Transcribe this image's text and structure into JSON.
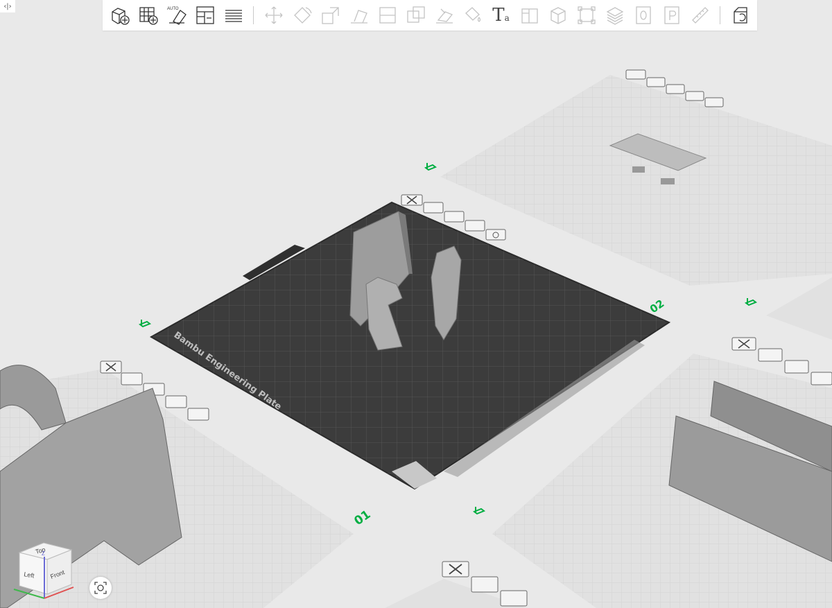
{
  "window": {
    "sidebar_toggle_glyph": "‹|›"
  },
  "toolbar": {
    "groups": [
      [
        "add-object",
        "add-plate",
        "auto-orient",
        "arrange",
        "split-to-layers"
      ],
      [
        "move",
        "rotate",
        "scale",
        "lay-on-face",
        "cut",
        "boolean",
        "support-paint",
        "seam-paint",
        "text",
        "variable-layer-height",
        "assembly",
        "measure-bounding",
        "layer-stack",
        "zero",
        "p-label",
        "ruler"
      ],
      [
        "assemble-view"
      ]
    ],
    "auto_label": "AUTO",
    "text_tool_glyph": "T",
    "text_tool_sub": "a"
  },
  "plates": {
    "active_plate_label": "Bambu Engineering Plate",
    "numbers": [
      "01",
      "02"
    ]
  },
  "view_cube": {
    "top": "Top",
    "left": "Left",
    "front": "Front",
    "axis_z": "Z"
  },
  "colors": {
    "accent": "#00ae42",
    "bed_dark": "#3f3f3f",
    "model_gray": "#9a9a9a",
    "grid_light": "#dcdcdc"
  }
}
